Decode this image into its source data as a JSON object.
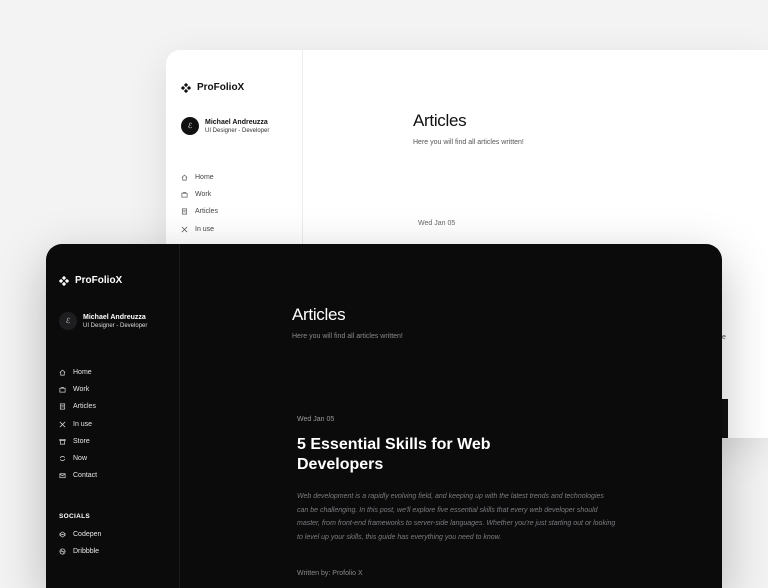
{
  "app": {
    "brand": "ProFolioX"
  },
  "profile": {
    "name": "Michael Andreuzza",
    "role": "UI Designer - Developer",
    "avatar_glyph": "ℰ"
  },
  "nav": [
    {
      "label": "Home",
      "icon": "home-icon"
    },
    {
      "label": "Work",
      "icon": "briefcase-icon"
    },
    {
      "label": "Articles",
      "icon": "document-icon"
    },
    {
      "label": "In use",
      "icon": "tools-icon"
    },
    {
      "label": "Store",
      "icon": "store-icon"
    },
    {
      "label": "Now",
      "icon": "refresh-icon"
    },
    {
      "label": "Contact",
      "icon": "mail-icon"
    }
  ],
  "socials": {
    "title": "SOCIALS",
    "items": [
      {
        "label": "Codepen",
        "icon": "codepen-icon"
      },
      {
        "label": "Dribbble",
        "icon": "dribbble-icon"
      }
    ]
  },
  "page": {
    "title": "Articles",
    "subtitle": "Here you will find all articles written!"
  },
  "article": {
    "date": "Wed Jan 05",
    "title": "5 Essential Skills for Web Developers",
    "excerpt": "Web development is a rapidly evolving field, and keeping up with the latest trends and technologies can be challenging. In this post, we'll explore five essential skills that every web developer should master, from front-end frameworks to server-side languages. Whether you're just starting out or looking to level up your skills, this guide has everything you need to know.",
    "author": "Written by: Profolio X"
  },
  "light_window": {
    "peek_letter": "e"
  },
  "colors": {
    "dark_bg": "#0b0b0c",
    "light_bg": "#ffffff",
    "page_bg": "#f3f3f4"
  }
}
